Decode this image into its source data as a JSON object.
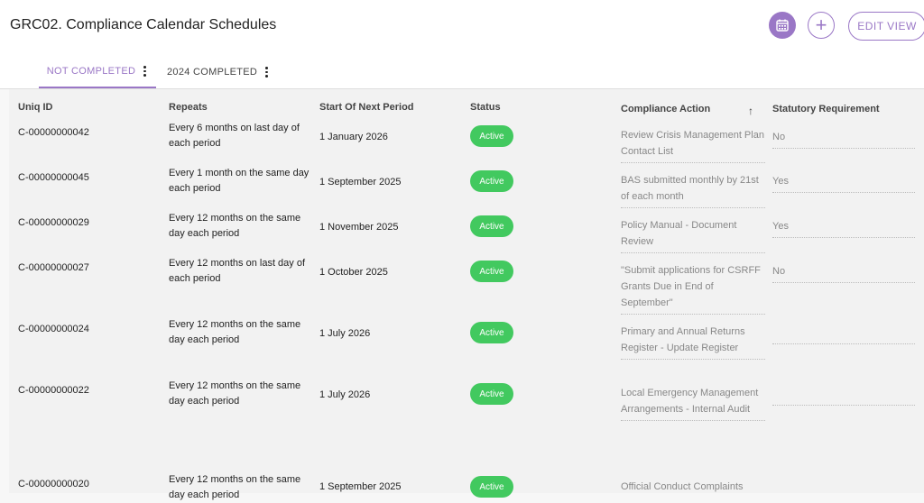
{
  "header": {
    "title": "GRC02. Compliance Calendar Schedules",
    "add_symbol": "+",
    "edit_view_label": "EDIT VIEW"
  },
  "tabs": [
    {
      "label": "NOT COMPLETED",
      "active": true
    },
    {
      "label": "2024 COMPLETED",
      "active": false
    }
  ],
  "table": {
    "columns": [
      "Uniq ID",
      "Repeats",
      "Start Of Next Period",
      "Status",
      "Compliance Action",
      "Statutory Requirement"
    ],
    "sort_indicator": "↑",
    "rows": [
      {
        "id": "C-00000000042",
        "repeats": "Every 6 months on last day of each period",
        "start": "1 January 2026",
        "status": "Active",
        "action": "Review Crisis Management Plan Contact List",
        "statutory": "No"
      },
      {
        "id": "C-00000000045",
        "repeats": "Every 1 month on the same day each period",
        "start": "1 September 2025",
        "status": "Active",
        "action": "BAS submitted monthly by 21st of each month",
        "statutory": "Yes"
      },
      {
        "id": "C-00000000029",
        "repeats": "Every 12 months on the same day each period",
        "start": "1 November 2025",
        "status": "Active",
        "action": "Policy Manual  - Document Review",
        "statutory": "Yes"
      },
      {
        "id": "C-00000000027",
        "repeats": "Every 12 months on last day of each period",
        "start": "1 October 2025",
        "status": "Active",
        "action": "\"Submit applications for CSRFF Grants Due in End of September\"",
        "statutory": "No"
      },
      {
        "id": "C-00000000024",
        "repeats": "Every 12 months on the same day each period",
        "start": "1 July 2026",
        "status": "Active",
        "action": "Primary and Annual Returns Register - Update Register",
        "statutory": ""
      },
      {
        "id": "C-00000000022",
        "repeats": "Every 12 months on the same day each period",
        "start": "1 July 2026",
        "status": "Active",
        "action": "Local Emergency Management Arrangements - Internal Audit",
        "statutory": ""
      },
      {
        "id": "C-00000000020",
        "repeats": "Every 12 months on the same day each period",
        "start": "1 September 2025",
        "status": "Active",
        "action": "Official Conduct Complaints",
        "statutory": ""
      }
    ]
  },
  "colors": {
    "accent": "#9a77c6",
    "status_active": "#42c95f"
  },
  "icons": [
    "calendar-icon",
    "plus-icon",
    "kebab-menu-icon",
    "sort-arrow-up-icon"
  ]
}
